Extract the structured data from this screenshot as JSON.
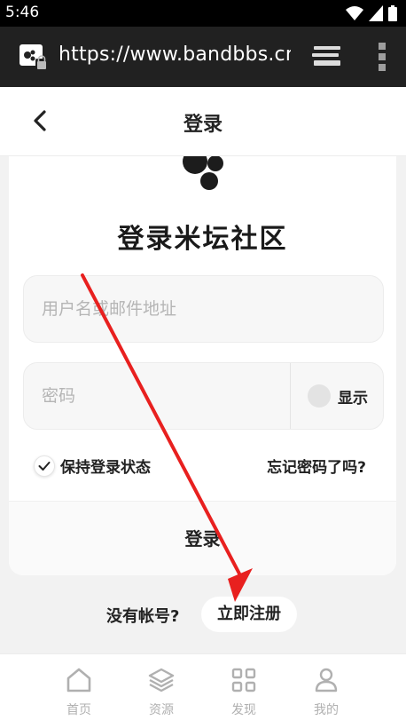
{
  "status_bar": {
    "time": "5:46"
  },
  "browser": {
    "url": "https://www.bandbbs.cn/"
  },
  "header": {
    "title": "登录"
  },
  "login_card": {
    "title": "登录米坛社区",
    "username_placeholder": "用户名或邮件地址",
    "password_placeholder": "密码",
    "show_password_label": "显示",
    "keep_login_label": "保持登录状态",
    "forgot_password_label": "忘记密码了吗?",
    "login_button_label": "登录"
  },
  "register": {
    "prompt": "没有帐号?",
    "button_label": "立即注册"
  },
  "tab_bar": {
    "items": [
      {
        "label": "首页",
        "icon": "home-icon"
      },
      {
        "label": "资源",
        "icon": "layers-icon"
      },
      {
        "label": "发现",
        "icon": "grid-icon"
      },
      {
        "label": "我的",
        "icon": "user-icon"
      }
    ]
  },
  "annotation": {
    "arrow_color": "#e8201f"
  }
}
